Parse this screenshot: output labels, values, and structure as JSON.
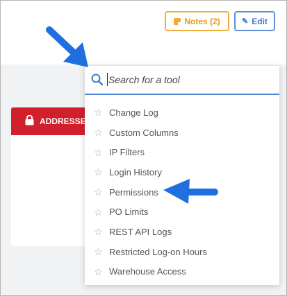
{
  "header": {
    "notes_label": "Notes (2)",
    "edit_label": "Edit"
  },
  "card": {
    "title": "ADDRESSES"
  },
  "search": {
    "placeholder": "Search for a tool",
    "value": ""
  },
  "tools": [
    {
      "label": "Change Log"
    },
    {
      "label": "Custom Columns"
    },
    {
      "label": "IP Filters"
    },
    {
      "label": "Login History"
    },
    {
      "label": "Permissions"
    },
    {
      "label": "PO Limits"
    },
    {
      "label": "REST API Logs"
    },
    {
      "label": "Restricted Log-on Hours"
    },
    {
      "label": "Warehouse Access"
    }
  ],
  "colors": {
    "notes_accent": "#f0ad3a",
    "edit_accent": "#3f7bcf",
    "card_header": "#d0202b",
    "arrow": "#1f6fe0"
  },
  "icons": [
    "notes-icon",
    "pencil-icon",
    "lock-icon",
    "search-icon",
    "star-icon",
    "arrow-icon"
  ]
}
